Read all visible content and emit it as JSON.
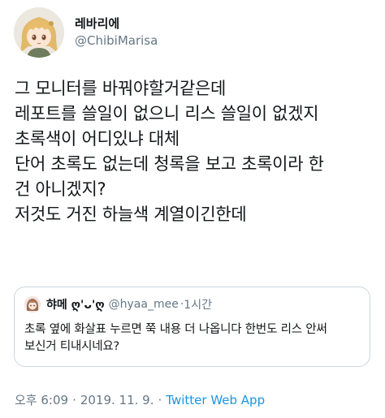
{
  "author": {
    "display_name": "레바리에",
    "handle": "@ChibiMarisa"
  },
  "tweet": {
    "lines": [
      "그 모니터를 바꿔야할거같은데",
      "레포트를 쓸일이 없으니 리스 쓸일이 없겠지",
      "초록색이 어디있냐 대체",
      "단어 초록도 없는데 청록을 보고 초록이라 한",
      "건 아니겠지?",
      "저것도 거진 하늘색 계열이긴한데"
    ]
  },
  "quoted_tweet": {
    "display_name": "햐메 ღ'ᴗ'ღ",
    "handle": "@hyaa_mee",
    "dot": "·",
    "time": "1시간",
    "lines": [
      "초록 옆에 화살표 누르면 쭉 내용 더 나옵니다 한번도 리스 안써",
      "보신거 티내시네요?"
    ]
  },
  "meta": {
    "time": "오후 6:09",
    "date": "2019. 11. 9.",
    "source": "Twitter Web App",
    "separator": "·"
  },
  "colors": {
    "text": "#14171a",
    "secondary": "#657786",
    "link": "#1b95e0",
    "border": "#ccd6dd"
  }
}
